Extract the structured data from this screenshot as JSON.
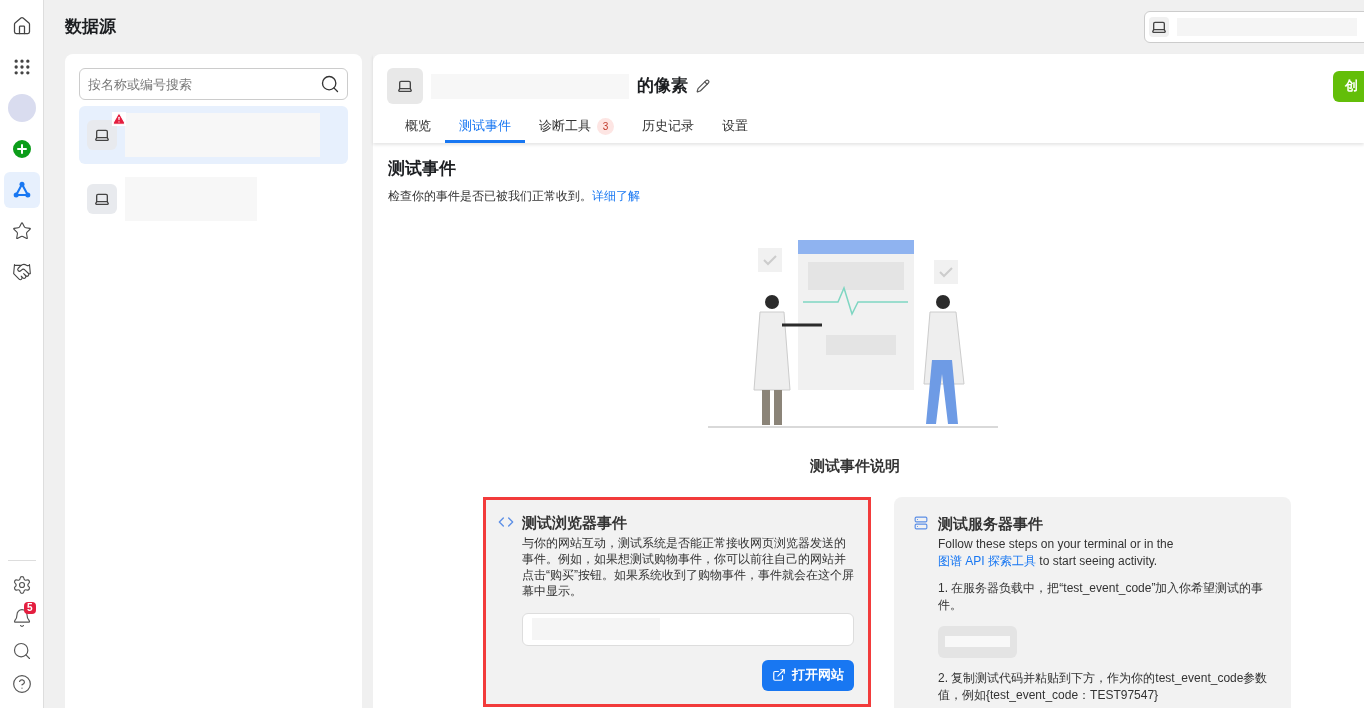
{
  "rail": {
    "items": [
      {
        "kind": "home",
        "selected": false
      },
      {
        "kind": "apps",
        "selected": false
      },
      {
        "kind": "account",
        "selected": false
      },
      {
        "kind": "add",
        "selected": false
      },
      {
        "kind": "nodes",
        "selected": true
      },
      {
        "kind": "star",
        "selected": false
      },
      {
        "kind": "handshake",
        "selected": false
      }
    ],
    "bottom": [
      {
        "kind": "settings"
      },
      {
        "kind": "bell",
        "badge": "5"
      },
      {
        "kind": "search"
      },
      {
        "kind": "help"
      }
    ]
  },
  "page_title": "数据源",
  "sources": {
    "search": {
      "placeholder": "按名称或编号搜索"
    },
    "items": [
      {
        "selected": true,
        "warning": true
      },
      {
        "selected": false,
        "warning": false
      }
    ]
  },
  "pixel": {
    "name_suffix": "的像素",
    "create_button": "创",
    "tabs": [
      {
        "label": "概览",
        "selected": false
      },
      {
        "label": "测试事件",
        "selected": true
      },
      {
        "label": "诊断工具",
        "selected": false,
        "badge": "3"
      },
      {
        "label": "历史记录",
        "selected": false
      },
      {
        "label": "设置",
        "selected": false
      }
    ]
  },
  "section": {
    "title": "测试事件",
    "description": "检查你的事件是否已被我们正常收到。",
    "link": "详细了解",
    "illustration_caption": "测试事件说明"
  },
  "browser_card": {
    "highlighted": true,
    "title": "测试浏览器事件",
    "body": "与你的网站互动，测试系统是否能正常接收网页浏览器发送的事件。例如，如果想测试购物事件，你可以前往自己的网站并点击“购买”按钮。如果系统收到了购物事件，事件就会在这个屏幕中显示。",
    "button": "打开网站"
  },
  "server_card": {
    "title": "测试服务器事件",
    "intro_before": "Follow these steps on your terminal or in the ",
    "intro_link": "图谱 API 探索工具",
    "intro_after": " to start seeing activity.",
    "step_1": "1. 在服务器负载中，把“test_event_code”加入你希望测试的事件。",
    "step_2": "2. 复制测试代码并粘贴到下方，作为你的test_event_code参数值，例如{test_event_code：TEST97547}"
  }
}
